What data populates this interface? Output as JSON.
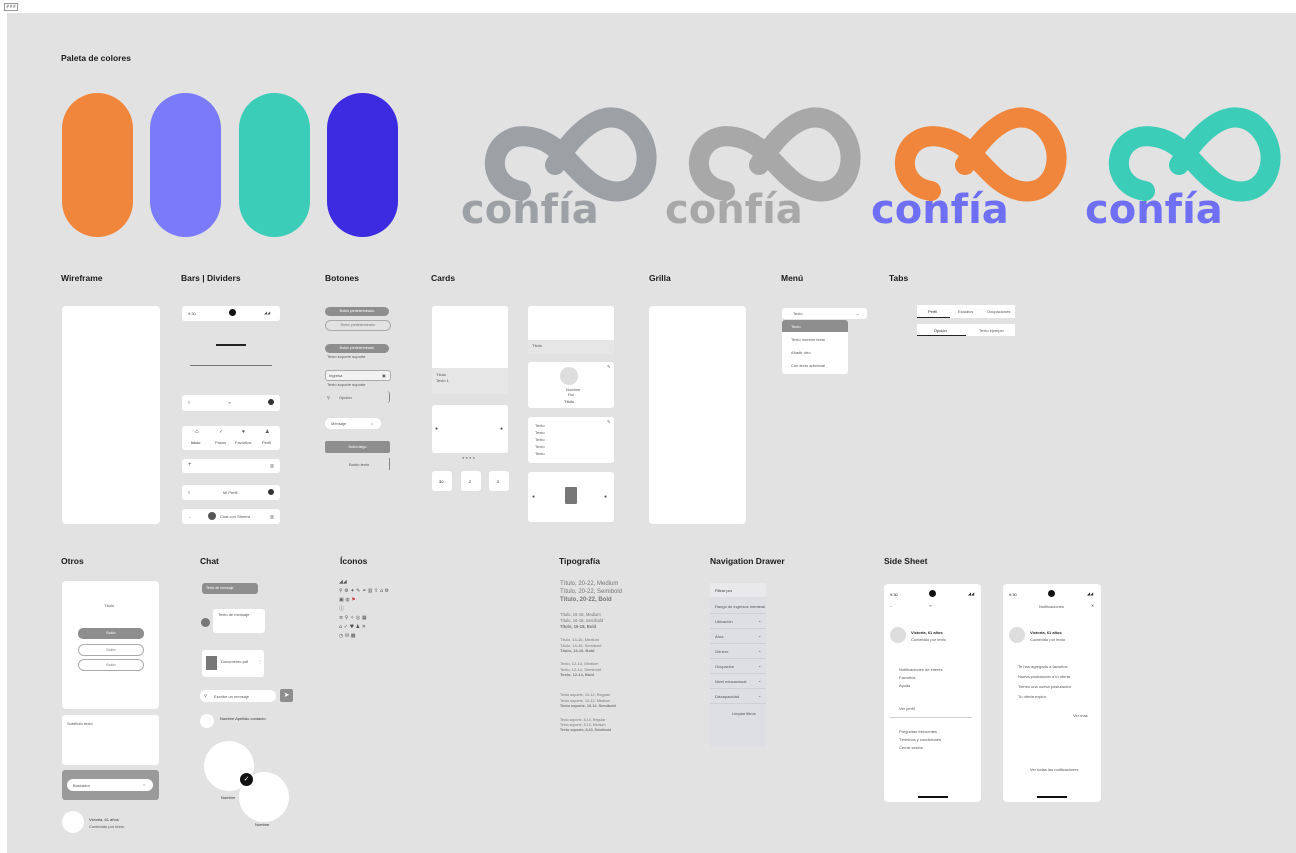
{
  "corner_badge": "###",
  "sections": {
    "palette": "Paleta de colores",
    "wireframe": "Wireframe",
    "bars": "Bars | Dividers",
    "buttons": "Botones",
    "cards": "Cards",
    "grid": "Grilla",
    "menu": "Menú",
    "tabs": "Tabs",
    "others": "Otros",
    "chat": "Chat",
    "icons": "Íconos",
    "typography": "Tipografía",
    "nav_drawer": "Navigation Drawer",
    "side_sheet": "Side Sheet"
  },
  "palette_colors": [
    "#f0863c",
    "#7a7afa",
    "#3ccdb9",
    "#3d2be2"
  ],
  "logo_text": "confía",
  "logos": [
    {
      "ring": "#9da0a5",
      "text": "#9da0a5"
    },
    {
      "ring": "#a8a8a8",
      "text": "#a8a8a8"
    },
    {
      "ring": "#f0863c",
      "text": "#6f6ff5"
    },
    {
      "ring": "#3ccdb9",
      "text": "#6f6ff5"
    }
  ],
  "bars": {
    "time": "9:30",
    "bottom_nav": [
      "Inicio",
      "Pasos",
      "Favoritos",
      "Perfil"
    ],
    "titled_bar": "Mi Perfil",
    "chat_bar": "Chat con Sheera"
  },
  "buttons": {
    "primary": "Botón predeterminado",
    "outlined": "Botón predeterminado",
    "with_support": "Botón predeterminado",
    "support_text": "Texto soporte soporte",
    "input_label": "Ingresa",
    "input_support": "Texto soporte soporte",
    "search": "Mensaje",
    "full": "Botón largo",
    "text_btn": "Botón texto",
    "select": "Opción"
  },
  "cards": {
    "title": "Título",
    "subtitle": "Texto 1",
    "name": "Nombre",
    "role": "Rol",
    "list_items": [
      "Texto",
      "Texto",
      "Texto",
      "Texto",
      "Texto"
    ],
    "mini": [
      "30",
      "2",
      "2"
    ]
  },
  "menu": {
    "selected": "Texto",
    "items": [
      "Texto",
      "Texto nombre texto",
      "Añadir otro",
      "Con texto adicional"
    ]
  },
  "tabs": {
    "row1": [
      "Perfil",
      "Estudios",
      "Ocupaciones"
    ],
    "row2": [
      "Opción",
      "Texto ejemplo"
    ]
  },
  "others": {
    "dialog_title": "Título",
    "buttons": [
      "Botón",
      "Botón",
      "Botón"
    ],
    "text_label": "Subtítulo texto",
    "search": "Buscador",
    "profile_name": "Victoria, 61 años",
    "profile_sub": "Contenido por texto"
  },
  "chat": {
    "bubble_out": "Texto de mensaje",
    "bubble_in": "Texto de mensaje",
    "file": "Documento.pdf",
    "input": "Escribe un mensaje",
    "profile": "Nombre Apellido contacto",
    "name1": "Nombre",
    "name2": "Nombre"
  },
  "typography": [
    "Título, 20-22, Medium",
    "Título, 20-22, Semibold",
    "Título, 20-22, Bold",
    "Título, 16-18, Medium",
    "Título, 16-18, Semibold",
    "Título, 16-18, Bold",
    "Título, 14-16, Medium",
    "Título, 14-16, Semibold",
    "Título, 14-16, Bold",
    "Texto, 12-14, Medium",
    "Texto, 12-14, Semibold",
    "Texto, 12-14, Bold",
    "Texto soporte, 10-12, Regular",
    "Texto soporte, 10-12, Medium",
    "Texto soporte, 10-12, Semibold",
    "Texto soporte, 8-10, Regular",
    "Texto soporte, 8-10, Medium",
    "Texto soporte, 8-10, Semibold"
  ],
  "nav_drawer": {
    "header": "Filtrar por",
    "items": [
      "Rango de ingresos mensual",
      "Ubicación",
      "Área",
      "Género",
      "Ocupación",
      "Nivel educacional",
      "Discapacidad"
    ],
    "clear": "Limpiar filtros"
  },
  "side_sheet": {
    "time": "9:30",
    "title": "Notificaciones",
    "name": "Victoria, 61 años",
    "sub": "Contenido por texto",
    "items_a": [
      "Notificaciones de interés",
      "Favoritos",
      "Ayuda"
    ],
    "done": "Ver perfil",
    "items_b": [
      "Preguntas frecuentes",
      "Términos y condiciones",
      "Cerrar sesión"
    ],
    "items_c": [
      "Te han agregado a favoritos",
      "Nueva postulación a tu oferta",
      "Tienes una nueva postulación",
      "Tu oferta expira"
    ],
    "more": "Ver más",
    "footer": "Ver todas las notificaciones"
  }
}
